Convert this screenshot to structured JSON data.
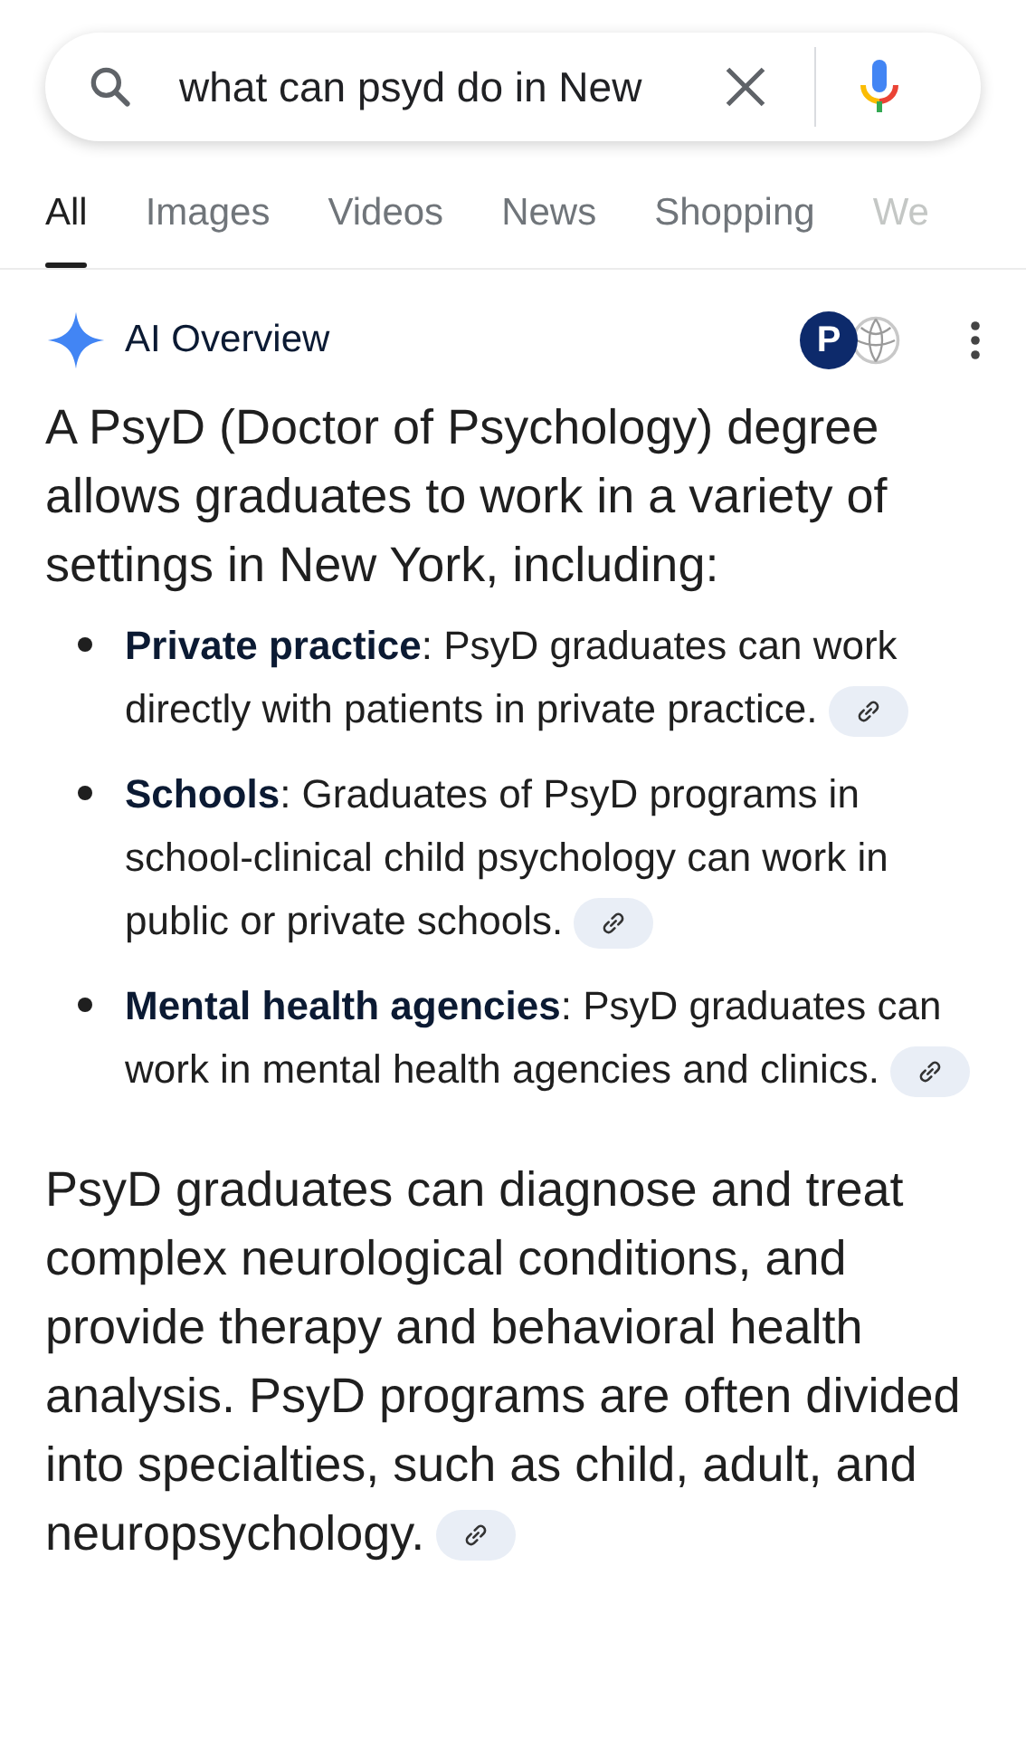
{
  "search": {
    "value": "what can psyd do in New"
  },
  "tabs": [
    {
      "label": "All",
      "selected": true
    },
    {
      "label": "Images",
      "selected": false
    },
    {
      "label": "Videos",
      "selected": false
    },
    {
      "label": "News",
      "selected": false
    },
    {
      "label": "Shopping",
      "selected": false
    },
    {
      "label": "We",
      "selected": false
    }
  ],
  "ai_overview": {
    "title": "AI Overview",
    "source_letter": "P",
    "intro": "A PsyD (Doctor of Psychology) degree allows graduates to work in a variety of settings in New York, including:",
    "bullets": [
      {
        "text": "**Private practice**: PsyD graduates can work directly with patients in private practice."
      },
      {
        "text": "**Schools**: Graduates of PsyD programs in school-clinical child psychology can work in public or private schools."
      },
      {
        "text": "**Mental health agencies**: PsyD graduates can work in mental health agencies and clinics."
      }
    ],
    "closing": "PsyD graduates can diagnose and treat complex neurological conditions, and provide therapy and behavioral health analysis. PsyD programs are often divided into specialties, such as child, adult, and neuropsychology."
  }
}
